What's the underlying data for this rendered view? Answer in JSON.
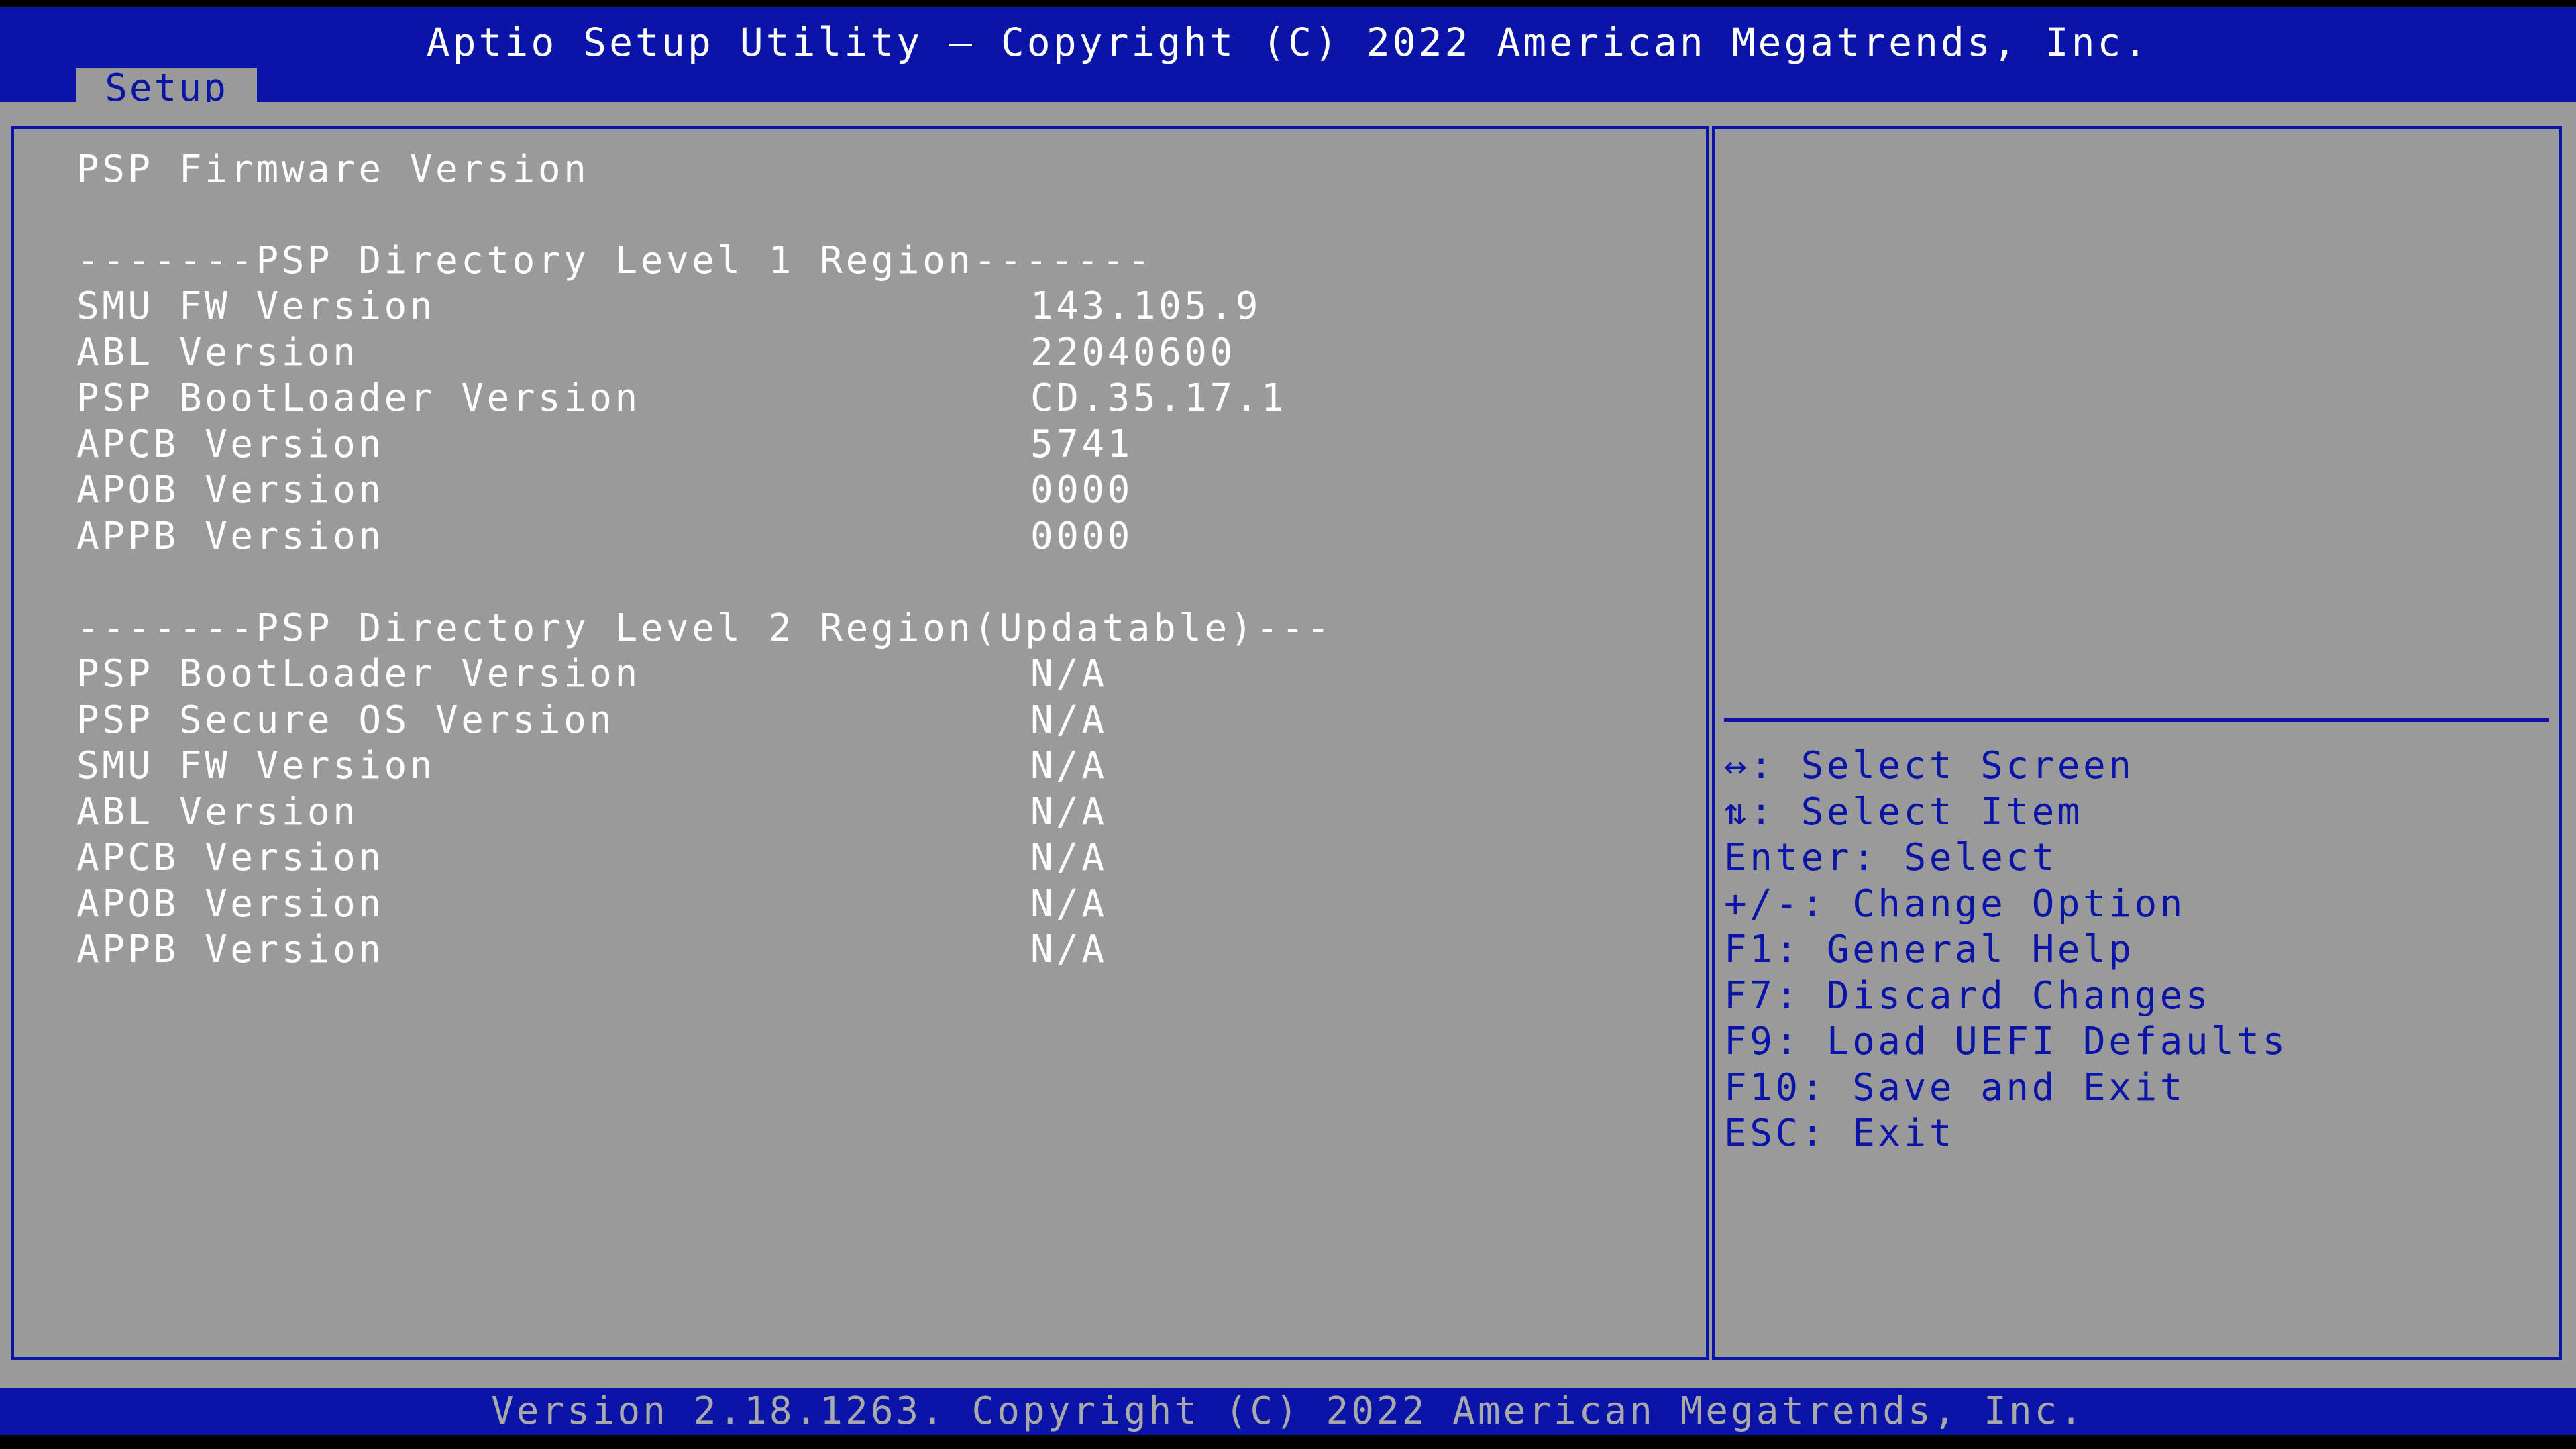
{
  "header": {
    "title": "Aptio Setup Utility – Copyright (C) 2022 American Megatrends, Inc.",
    "tabs": [
      "Setup"
    ]
  },
  "main": {
    "heading": "PSP Firmware Version",
    "section1": {
      "title": "-------PSP Directory Level 1 Region-------",
      "rows": [
        {
          "label": "SMU FW Version",
          "value": "143.105.9"
        },
        {
          "label": "ABL Version",
          "value": "22040600"
        },
        {
          "label": "PSP BootLoader Version",
          "value": "CD.35.17.1"
        },
        {
          "label": "APCB Version",
          "value": "5741"
        },
        {
          "label": "APOB Version",
          "value": "0000"
        },
        {
          "label": "APPB Version",
          "value": "0000"
        }
      ]
    },
    "section2": {
      "title": "-------PSP Directory Level 2 Region(Updatable)---",
      "rows": [
        {
          "label": "PSP BootLoader Version",
          "value": "N/A"
        },
        {
          "label": "PSP Secure OS Version",
          "value": "N/A"
        },
        {
          "label": "SMU FW Version",
          "value": "N/A"
        },
        {
          "label": "ABL Version",
          "value": "N/A"
        },
        {
          "label": "APCB Version",
          "value": "N/A"
        },
        {
          "label": "APOB Version",
          "value": "N/A"
        },
        {
          "label": "APPB Version",
          "value": "N/A"
        }
      ]
    }
  },
  "help": {
    "keys": [
      {
        "key": "↔:",
        "desc": " Select Screen"
      },
      {
        "key": "⇅:",
        "desc": " Select Item"
      },
      {
        "key": "Enter:",
        "desc": " Select"
      },
      {
        "key": "+/-:",
        "desc": " Change Option"
      },
      {
        "key": "F1:",
        "desc": " General Help"
      },
      {
        "key": "F7:",
        "desc": " Discard Changes"
      },
      {
        "key": "F9:",
        "desc": " Load UEFI Defaults"
      },
      {
        "key": "F10:",
        "desc": " Save and Exit"
      },
      {
        "key": "ESC:",
        "desc": " Exit"
      }
    ]
  },
  "footer": {
    "version": "Version 2.18.1263. Copyright (C) 2022 American Megatrends, Inc."
  },
  "colors": {
    "accent": "#0a15a8",
    "panel": "#9a9a9a",
    "text": "#ffffff"
  }
}
